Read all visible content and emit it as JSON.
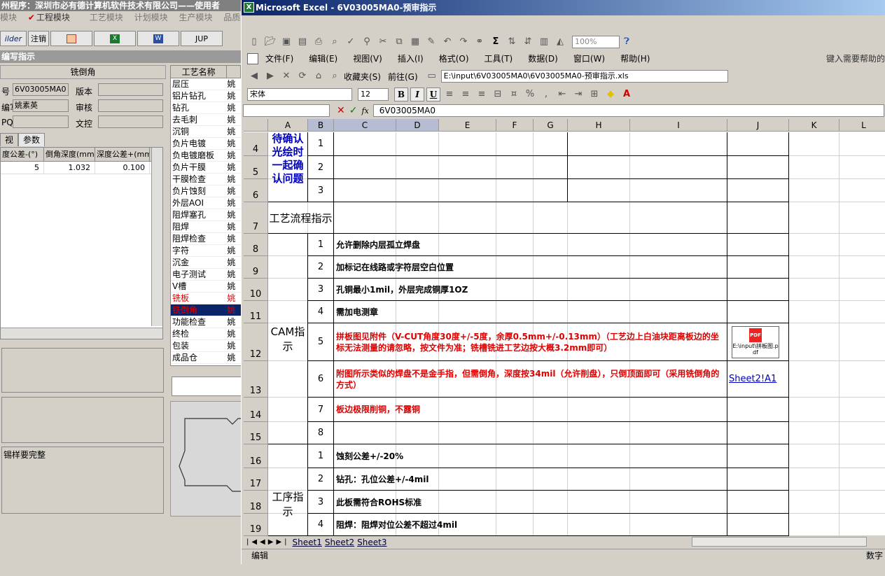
{
  "bg_app": {
    "title": "州程序：深圳市必有德计算机软件技术有限公司——使用者",
    "menu": [
      "模块",
      "工程模块",
      "工艺模块",
      "计划模块",
      "生产模块",
      "品质模块"
    ],
    "toolbar": {
      "builder": "ilder",
      "logout": "注销",
      "jup": "JUP"
    },
    "caption": "编写指示",
    "form_title": "铣倒角",
    "fields": {
      "part_no_label": "号",
      "part_no": "6V03005MA0",
      "version_label": "版本",
      "writer_label": "编写",
      "writer": "姚素英",
      "review_label": "审核",
      "pqe_label": "PQE",
      "doc_ctrl_label": "文控"
    },
    "tabs": [
      "视",
      "参数"
    ],
    "param_grid": {
      "headers": [
        "度公差-(°)",
        "倒角深度(mm)",
        "深度公差+(mm)"
      ],
      "row": [
        "5",
        "1.032",
        "0.100"
      ]
    },
    "memo3_text": "锡样要完整",
    "process": {
      "header": "工艺名称",
      "items": [
        {
          "name": "层压",
          "user": "姚"
        },
        {
          "name": "铝片钻孔",
          "user": "姚"
        },
        {
          "name": "钻孔",
          "user": "姚"
        },
        {
          "name": "去毛刺",
          "user": "姚"
        },
        {
          "name": "沉铜",
          "user": "姚"
        },
        {
          "name": "负片电镀",
          "user": "姚"
        },
        {
          "name": "负电镀磨板",
          "user": "姚"
        },
        {
          "name": "负片干膜",
          "user": "姚"
        },
        {
          "name": "干膜检查",
          "user": "姚"
        },
        {
          "name": "负片蚀刻",
          "user": "姚"
        },
        {
          "name": "外层AOI",
          "user": "姚"
        },
        {
          "name": "阻焊塞孔",
          "user": "姚"
        },
        {
          "name": "阻焊",
          "user": "姚"
        },
        {
          "name": "阻焊检查",
          "user": "姚"
        },
        {
          "name": "字符",
          "user": "姚"
        },
        {
          "name": "沉金",
          "user": "姚"
        },
        {
          "name": "电子测试",
          "user": "姚"
        },
        {
          "name": "V槽",
          "user": "姚"
        },
        {
          "name": "铣板",
          "user": "姚"
        },
        {
          "name": "铣倒角",
          "user": "姚"
        },
        {
          "name": "功能检查",
          "user": "姚"
        },
        {
          "name": "终检",
          "user": "姚"
        },
        {
          "name": "包装",
          "user": "姚"
        },
        {
          "name": "成品仓",
          "user": "姚"
        }
      ]
    }
  },
  "excel": {
    "title": "Microsoft Excel - 6V03005MA0-预审指示",
    "menu": [
      "文件(F)",
      "编辑(E)",
      "视图(V)",
      "插入(I)",
      "格式(O)",
      "工具(T)",
      "数据(D)",
      "窗口(W)",
      "帮助(H)"
    ],
    "help_box": "键入需要帮助的",
    "zoom": "100%",
    "web": {
      "favorites": "收藏夹(S)",
      "goto": "前往(G)",
      "url": "E:\\input\\6V03005MA0\\6V03005MA0-预审指示.xls"
    },
    "font": "宋体",
    "font_size": "12",
    "fmt": {
      "bold": "B",
      "italic": "I",
      "underline": "U"
    },
    "formula": {
      "fx": "fx",
      "value": "6V03005MA0"
    },
    "columns": [
      "A",
      "B",
      "C",
      "D",
      "E",
      "F",
      "G",
      "H",
      "I",
      "J",
      "K",
      "L"
    ],
    "rows": [
      "4",
      "5",
      "6",
      "7",
      "8",
      "9",
      "10",
      "11",
      "12",
      "13",
      "14",
      "15",
      "16",
      "17",
      "18",
      "19"
    ],
    "section_confirm": "待确认光绘时一起确认问题",
    "section_flow": "工艺流程指示",
    "section_cam": "CAM指示",
    "section_proc": "工序指示",
    "confirm_nums": [
      "1",
      "2",
      "3"
    ],
    "cam_items": [
      {
        "n": "1",
        "text": "允许删除内层孤立焊盘",
        "red": false
      },
      {
        "n": "2",
        "text": "加标记在线路或字符层空白位置",
        "red": false
      },
      {
        "n": "3",
        "text": "孔铜最小1mil，外层完成铜厚1OZ",
        "red": false
      },
      {
        "n": "4",
        "text": "需加电测章",
        "red": false
      },
      {
        "n": "5",
        "text": "拼板图见附件（V-CUT角度30度+/-5度，余厚0.5mm+/-0.13mm）（工艺边上白油块距离板边的坐标无法测量的请忽略，按文件为准；铣槽铣进工艺边按大概3.2mm即可）",
        "red": true
      },
      {
        "n": "6",
        "text": "附图所示类似的焊盘不是金手指，但需倒角，深度按34mil（允许削盘），只倒顶面即可（采用铣倒角的方式）",
        "red": true
      },
      {
        "n": "7",
        "text": "板边极限削铜，不露铜",
        "red": true
      },
      {
        "n": "8",
        "text": "",
        "red": false
      }
    ],
    "proc_items": [
      {
        "n": "1",
        "text": "蚀刻公差+/-20%"
      },
      {
        "n": "2",
        "text": "钻孔：孔位公差+/-4mil"
      },
      {
        "n": "3",
        "text": "此板需符合ROHS标准"
      },
      {
        "n": "4",
        "text": "阻焊：阻焊对位公差不超过4mil"
      }
    ],
    "attachment_label": "E:\\input\\拼板图.pdf",
    "link_text": "Sheet2!A1",
    "sheet_tabs": [
      "Sheet1",
      "Sheet2",
      "Sheet3"
    ],
    "status_left": "编辑",
    "status_right": "数字"
  }
}
